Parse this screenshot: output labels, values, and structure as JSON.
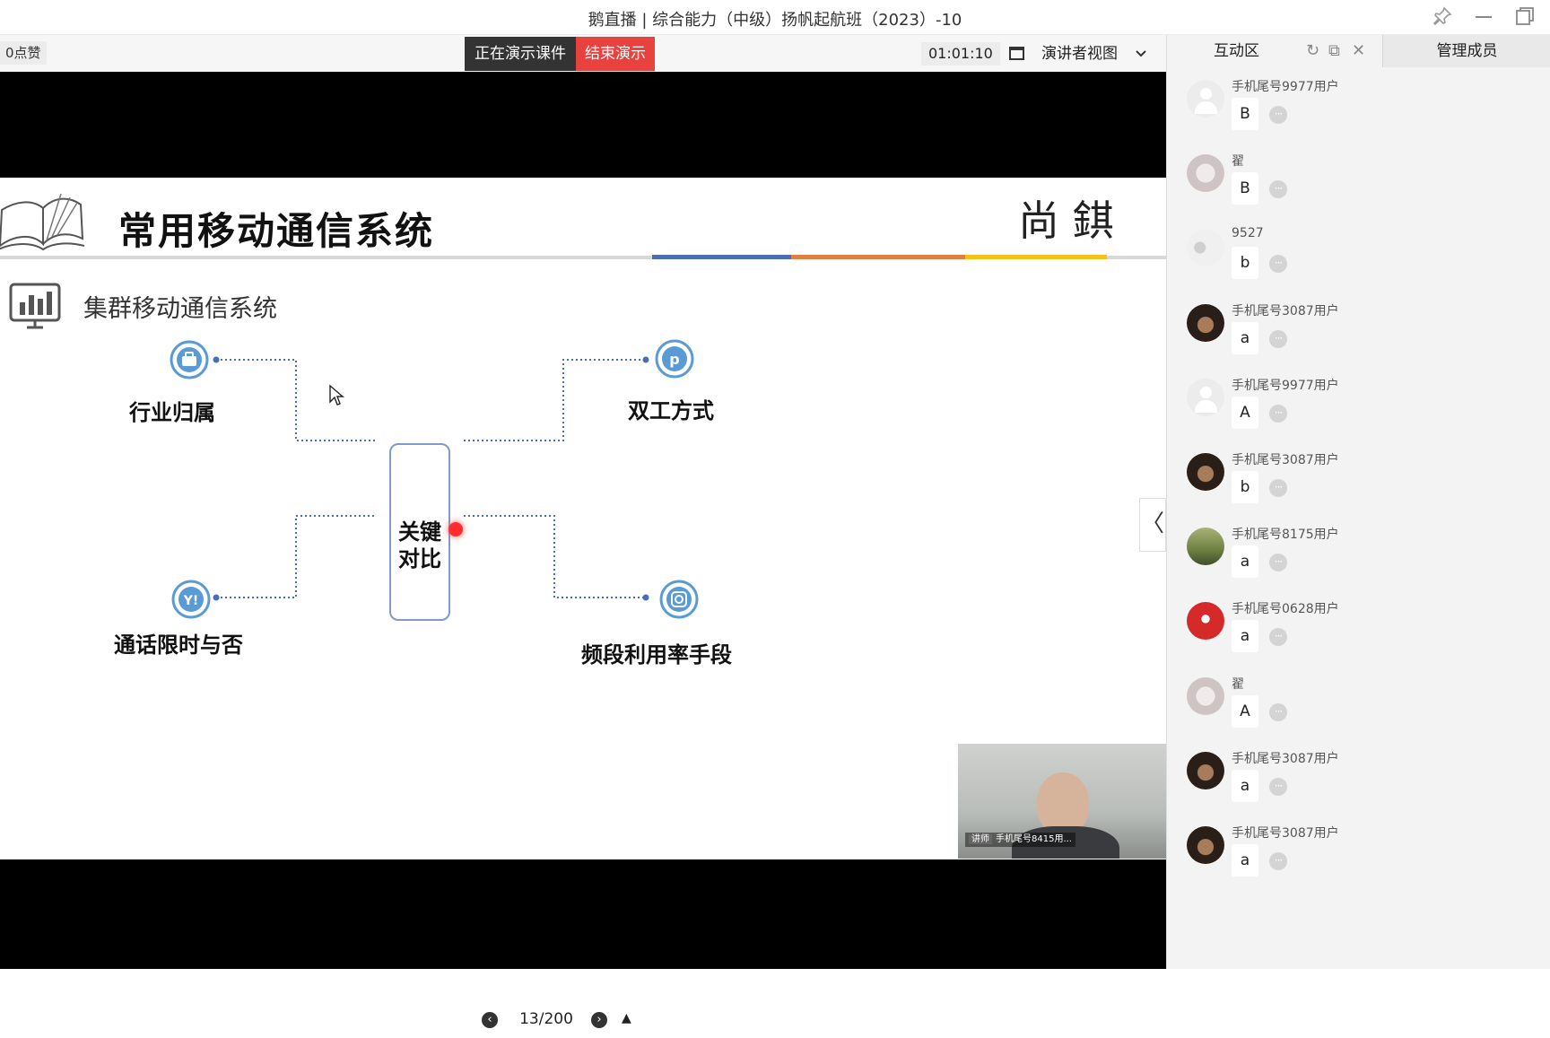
{
  "window": {
    "title": "鹅直播 | 综合能力（中级）扬帆起航班（2023）-10"
  },
  "toolbar": {
    "likes": "0点赞",
    "presenting": "正在演示课件",
    "end_presenting": "结束演示",
    "timer": "01:01:10",
    "view_mode": "演讲者视图"
  },
  "slide": {
    "title": "常用移动通信系统",
    "seal": "尚 錤",
    "subtitle": "集群移动通信系统",
    "center_line1": "关键",
    "center_line2": "对比",
    "labels": {
      "top_left": "行业归属",
      "top_right": "双工方式",
      "bottom_left": "通话限时与否",
      "bottom_right": "频段利用率手段"
    }
  },
  "camera": {
    "role": "讲师",
    "name": "手机尾号8415用..."
  },
  "pager": {
    "current": "13/200"
  },
  "panel": {
    "tab_interact": "互动区",
    "tab_members": "管理成员"
  },
  "chat": [
    {
      "user": "手机尾号9977用户",
      "text": "B",
      "avatar": "default"
    },
    {
      "user": "翟",
      "text": "B",
      "avatar": "light"
    },
    {
      "user": "9527",
      "text": "b",
      "avatar": "cartoon"
    },
    {
      "user": "手机尾号3087用户",
      "text": "a",
      "avatar": "dark"
    },
    {
      "user": "手机尾号9977用户",
      "text": "A",
      "avatar": "default"
    },
    {
      "user": "手机尾号3087用户",
      "text": "b",
      "avatar": "dark"
    },
    {
      "user": "手机尾号8175用户",
      "text": "a",
      "avatar": "nature"
    },
    {
      "user": "手机尾号0628用户",
      "text": "a",
      "avatar": "red"
    },
    {
      "user": "翟",
      "text": "A",
      "avatar": "light"
    },
    {
      "user": "手机尾号3087用户",
      "text": "a",
      "avatar": "dark"
    },
    {
      "user": "手机尾号3087用户",
      "text": "a",
      "avatar": "dark"
    }
  ],
  "colors": {
    "end_button": "#e8413e",
    "rule_blue": "#4a6db5",
    "rule_orange": "#e08040",
    "rule_yellow": "#f2c21a",
    "diagram_line": "#4a6db5",
    "diagram_node": "#5b9bd5"
  }
}
